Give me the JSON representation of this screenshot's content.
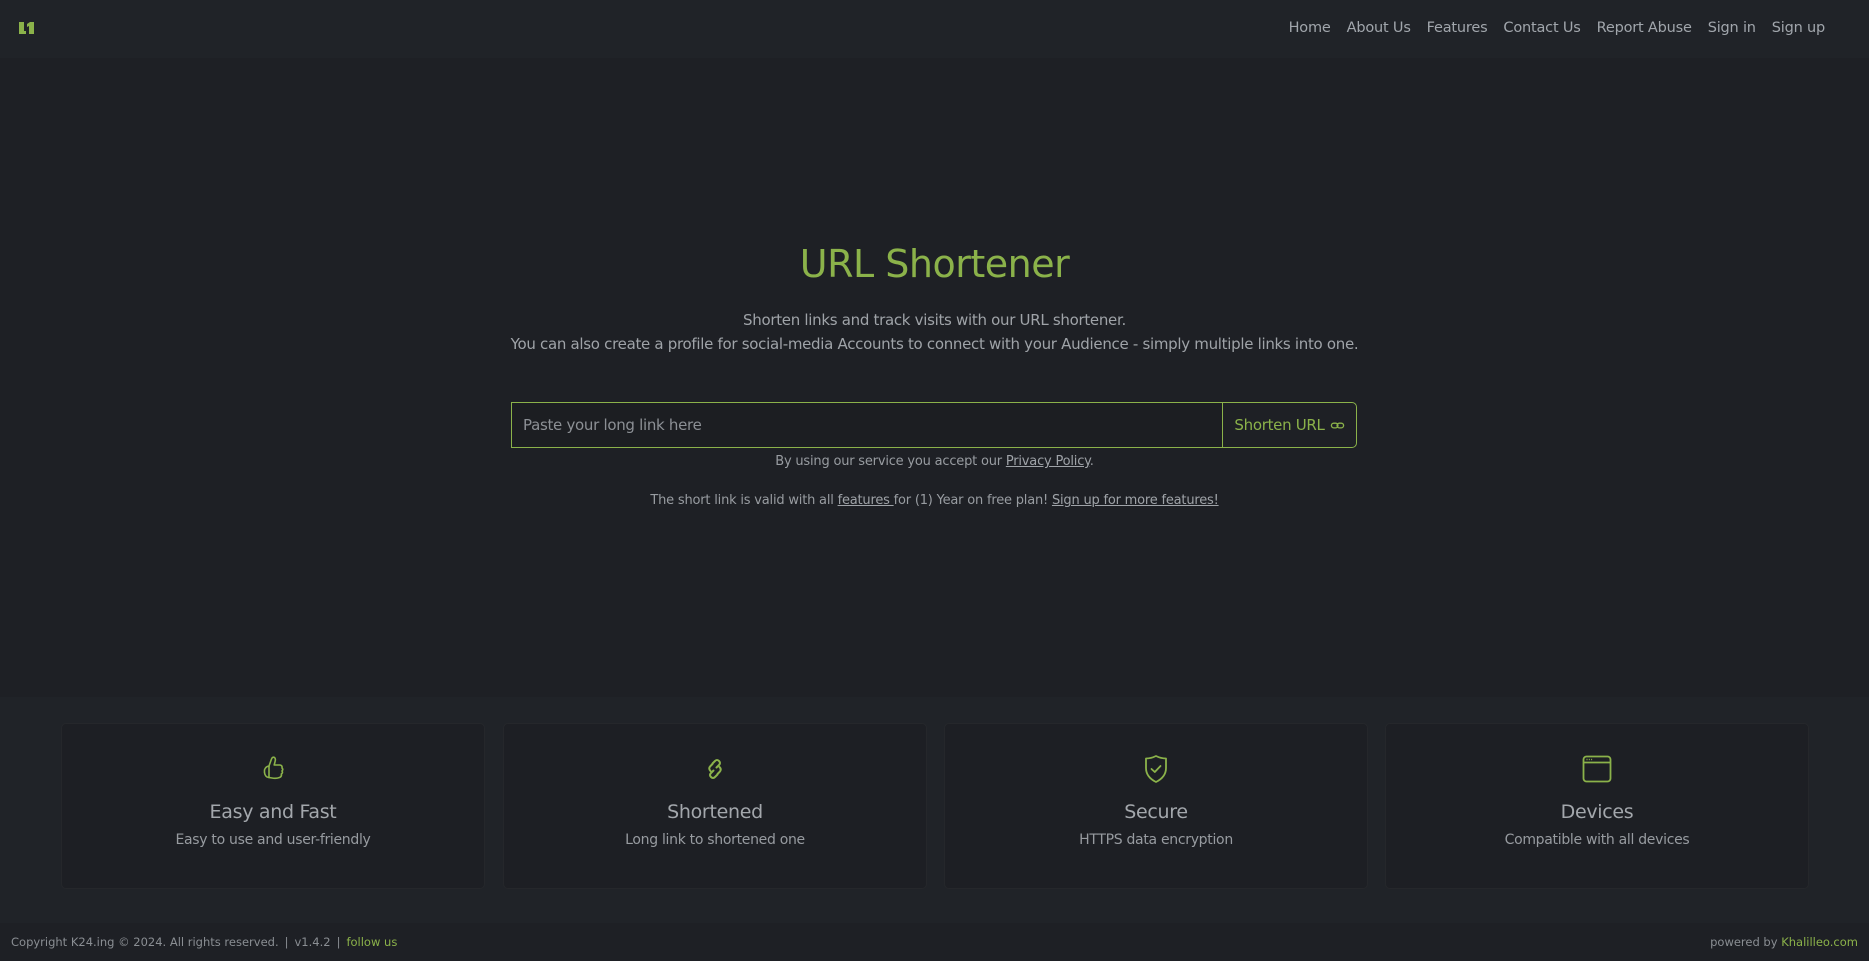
{
  "theme": {
    "accent": "#8bb24a",
    "background": "#1e2025",
    "header_background": "#202328",
    "text": "#9a9ea4"
  },
  "header": {
    "logo_icon": "k24-logo-icon",
    "nav": [
      {
        "label": "Home"
      },
      {
        "label": "About Us"
      },
      {
        "label": "Features"
      },
      {
        "label": "Contact Us"
      },
      {
        "label": "Report Abuse"
      },
      {
        "label": "Sign in"
      },
      {
        "label": "Sign up"
      }
    ]
  },
  "hero": {
    "title": "URL Shortener",
    "subtitle_line1": "Shorten links and track visits with our URL shortener.",
    "subtitle_line2": "You can also create a profile for social-media Accounts to connect with your Audience - simply multiple links into one.",
    "input": {
      "value": "",
      "placeholder": "Paste your long link here"
    },
    "shorten_button": {
      "label": "Shorten URL",
      "icon": "link-icon"
    },
    "policy_note": {
      "prefix": "By using our service you accept our ",
      "link": "Privacy Policy",
      "suffix": "."
    },
    "plan_note": {
      "prefix": "The short link is valid with all ",
      "features_link": "features ",
      "middle": "for (1) Year on free plan! ",
      "signup_link": "Sign up for more features!"
    }
  },
  "features": [
    {
      "icon": "thumbs-up-icon",
      "title": "Easy and Fast",
      "description": "Easy to use and user-friendly"
    },
    {
      "icon": "link-icon",
      "title": "Shortened",
      "description": "Long link to shortened one"
    },
    {
      "icon": "shield-check-icon",
      "title": "Secure",
      "description": "HTTPS data encryption"
    },
    {
      "icon": "browser-window-icon",
      "title": "Devices",
      "description": "Compatible with all devices"
    }
  ],
  "footer": {
    "copyright": "Copyright K24.ing © 2024. All rights reserved.",
    "separator": "|",
    "version": "v1.4.2",
    "follow_link": "follow us",
    "powered_prefix": "powered by ",
    "powered_link": "Khalilleo.com"
  }
}
